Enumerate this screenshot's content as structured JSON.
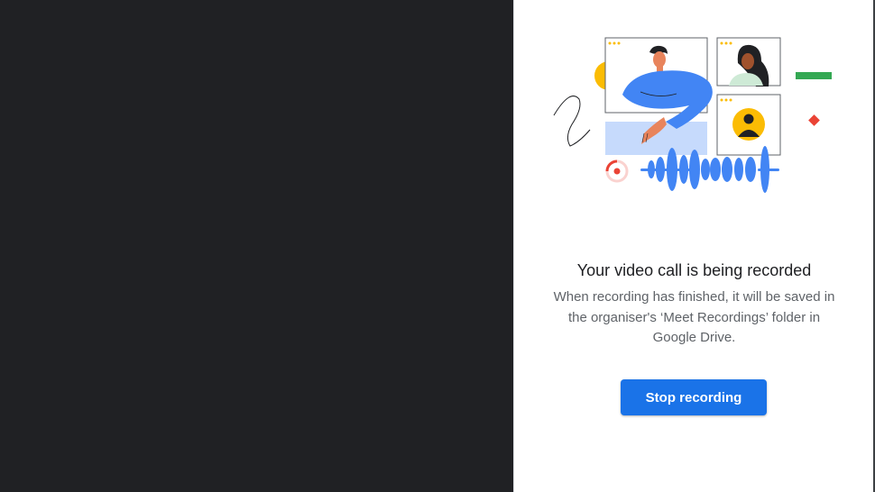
{
  "recording_panel": {
    "title": "Your video call is being recorded",
    "description": "When recording has finished, it will be saved in the organiser's ‘Meet Recordings’ folder in Google Drive.",
    "stop_button_label": "Stop recording"
  },
  "colors": {
    "dark_background": "#202124",
    "panel_background": "#ffffff",
    "accent_blue": "#1a73e8",
    "illustration_blue": "#4285f4",
    "recording_red": "#ea4335",
    "yellow": "#fbbc04",
    "green": "#34a853"
  },
  "icons": {
    "illustration": "recording-video-call-illustration",
    "recording_indicator": "record-dot-icon",
    "audio_waveform": "waveform-icon"
  }
}
